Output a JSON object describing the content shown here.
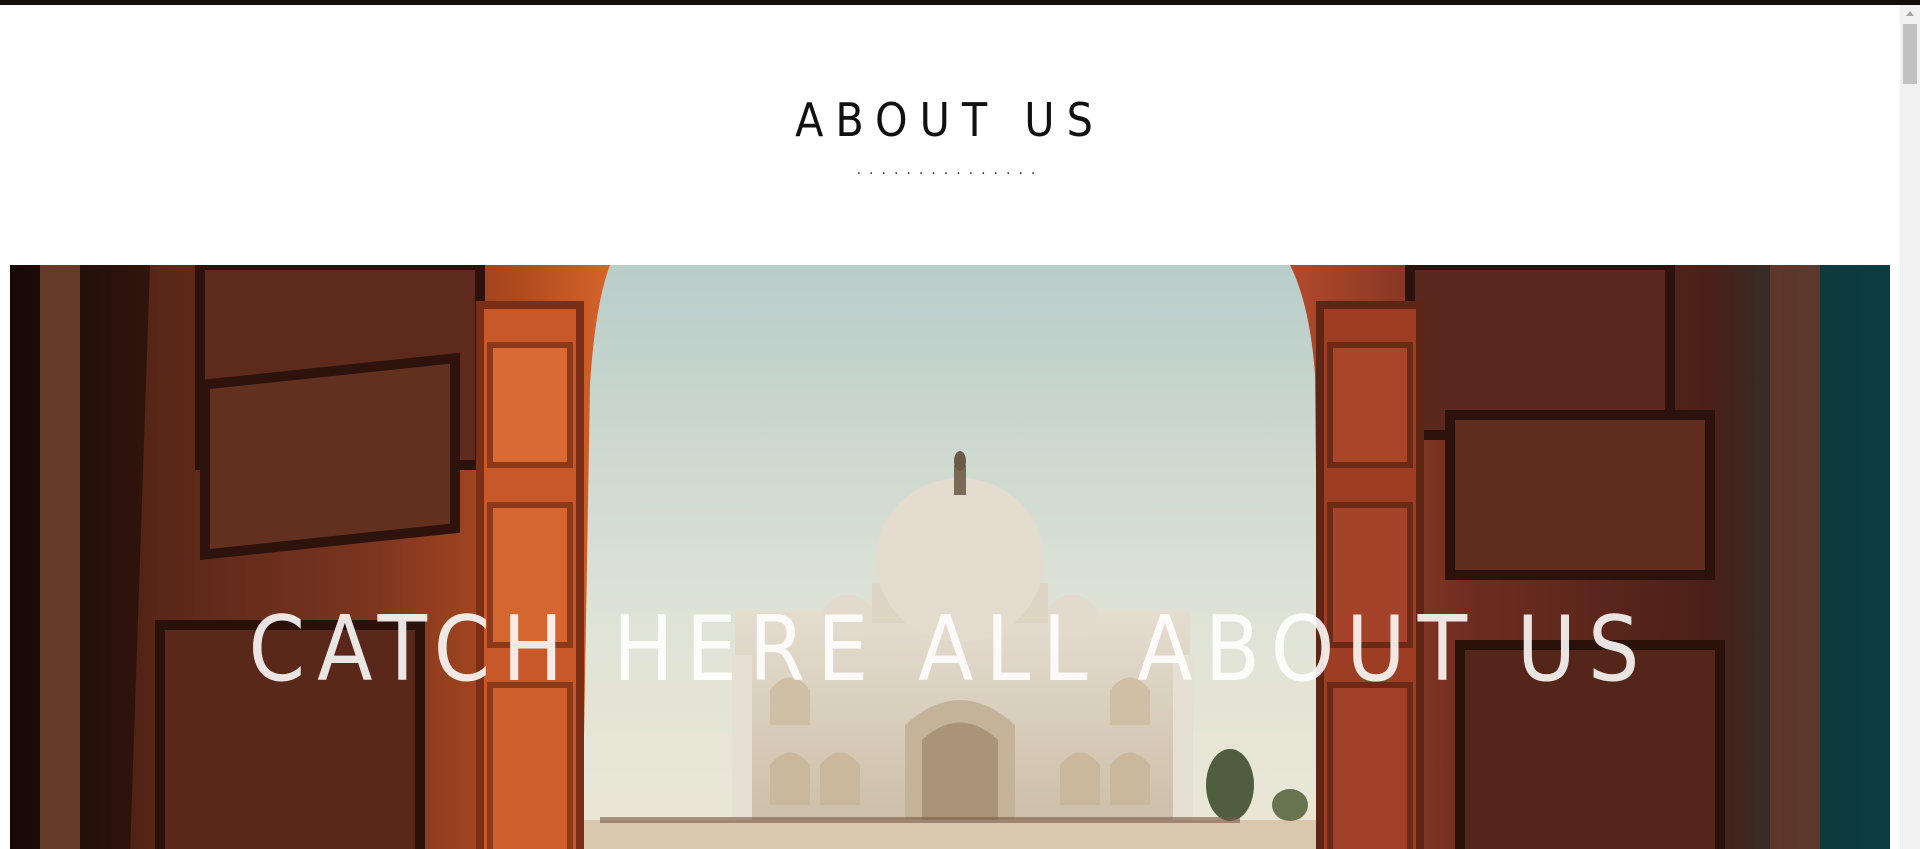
{
  "section": {
    "title": "ABOUT US",
    "divider_dots": "..............."
  },
  "hero": {
    "headline": "CATCH HERE ALL ABOUT US",
    "image": "taj-mahal-through-carved-doors-photo"
  },
  "colors": {
    "top_border": "#140d0a",
    "title_text": "#111111",
    "hero_text": "#ffffff",
    "scrollbar_track": "#f1f1f1",
    "scrollbar_thumb": "#c1c1c1"
  }
}
